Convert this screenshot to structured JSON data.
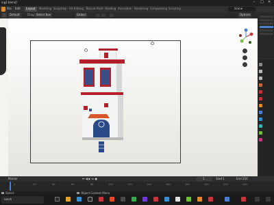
{
  "app": {
    "title": "ing2.blend]"
  },
  "menu": {
    "file": "File",
    "edit": "Edit",
    "tabs": [
      "Layout",
      "Modeling",
      "Sculpting",
      "UV Editing",
      "Texture Paint",
      "Shading",
      "Animation",
      "Rendering",
      "Compositing",
      "Scripting"
    ],
    "active_tab": 0,
    "scene": "Scene"
  },
  "header": {
    "orientation": "Default",
    "drag": "Drag:",
    "select": "Select Box",
    "transform": "Global",
    "options": "Options"
  },
  "viewport_mode": {
    "items": [
      "Object",
      "View",
      "Select",
      "Add",
      "Object"
    ]
  },
  "timeline": {
    "marker": "Marker",
    "start_label": "Start",
    "start": "1",
    "end_label": "End",
    "end": "250",
    "current": "1",
    "ticks": [
      "0",
      "20",
      "40",
      "60",
      "80",
      "100",
      "120",
      "140",
      "160",
      "180",
      "200",
      "220",
      "240"
    ]
  },
  "status": {
    "left": "Select",
    "mid": "Object Context Menu"
  },
  "taskbar": {
    "search": "earch"
  },
  "colors": {
    "accent": "#4a7fd1",
    "house_red": "#b3202a",
    "house_white": "#f2f2f2",
    "door_blue": "#2a4a8a"
  }
}
